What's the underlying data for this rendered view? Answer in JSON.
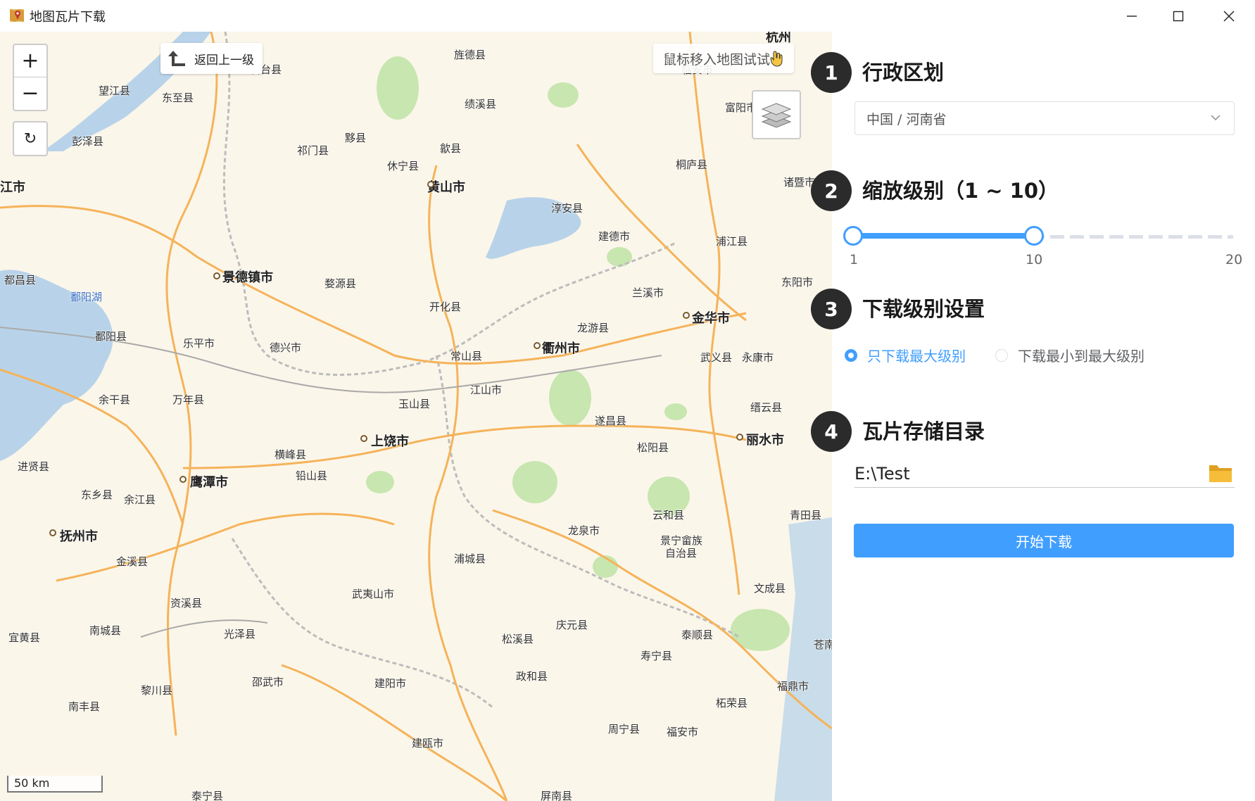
{
  "window": {
    "title": "地图瓦片下载"
  },
  "map": {
    "back_label": "返回上一级",
    "hint_text": "鼠标移入地图试试",
    "zoom_in": "+",
    "zoom_out": "−",
    "reset": "↻",
    "scale_label": "50 km",
    "cities": [
      {
        "name": "杭州",
        "major": true
      },
      {
        "name": "旌德县"
      },
      {
        "name": "望江县"
      },
      {
        "name": "东至县"
      },
      {
        "name": "石台县"
      },
      {
        "name": "临安市"
      },
      {
        "name": "绩溪县"
      },
      {
        "name": "富阳市"
      },
      {
        "name": "彭泽县"
      },
      {
        "name": "黟县"
      },
      {
        "name": "祁门县"
      },
      {
        "name": "歙县"
      },
      {
        "name": "休宁县"
      },
      {
        "name": "桐庐县"
      },
      {
        "name": "黄山市",
        "major": true
      },
      {
        "name": "江市"
      },
      {
        "name": "诸暨市"
      },
      {
        "name": "淳安县"
      },
      {
        "name": "建德市"
      },
      {
        "name": "浦江县"
      },
      {
        "name": "都昌县"
      },
      {
        "name": "景德镇市",
        "major": true
      },
      {
        "name": "婺源县"
      },
      {
        "name": "东阳市"
      },
      {
        "name": "鄱阳湖",
        "water": true
      },
      {
        "name": "兰溪市"
      },
      {
        "name": "开化县"
      },
      {
        "name": "金华市",
        "major": true
      },
      {
        "name": "龙游县"
      },
      {
        "name": "鄱阳县"
      },
      {
        "name": "乐平市"
      },
      {
        "name": "德兴市"
      },
      {
        "name": "常山县"
      },
      {
        "name": "衢州市",
        "major": true
      },
      {
        "name": "武义县"
      },
      {
        "name": "永康市"
      },
      {
        "name": "江山市"
      },
      {
        "name": "余干县"
      },
      {
        "name": "万年县"
      },
      {
        "name": "玉山县"
      },
      {
        "name": "缙云县"
      },
      {
        "name": "遂昌县"
      },
      {
        "name": "松阳县"
      },
      {
        "name": "丽水市",
        "major": true
      },
      {
        "name": "横峰县"
      },
      {
        "name": "上饶市",
        "major": true
      },
      {
        "name": "进贤县"
      },
      {
        "name": "铅山县"
      },
      {
        "name": "东乡县"
      },
      {
        "name": "余江县"
      },
      {
        "name": "鹰潭市",
        "major": true
      },
      {
        "name": "青田县"
      },
      {
        "name": "云和县"
      },
      {
        "name": "龙泉市"
      },
      {
        "name": "景宁畲族"
      },
      {
        "name": "自治县"
      },
      {
        "name": "抚州市",
        "major": true
      },
      {
        "name": "金溪县"
      },
      {
        "name": "浦城县"
      },
      {
        "name": "资溪县"
      },
      {
        "name": "武夷山市"
      },
      {
        "name": "文成县"
      },
      {
        "name": "庆元县"
      },
      {
        "name": "宜黄县"
      },
      {
        "name": "南城县"
      },
      {
        "name": "光泽县"
      },
      {
        "name": "松溪县"
      },
      {
        "name": "泰顺县"
      },
      {
        "name": "苍南"
      },
      {
        "name": "寿宁县"
      },
      {
        "name": "邵武市"
      },
      {
        "name": "政和县"
      },
      {
        "name": "建阳市"
      },
      {
        "name": "福鼎市"
      },
      {
        "name": "黎川县"
      },
      {
        "name": "柘荣县"
      },
      {
        "name": "南丰县"
      },
      {
        "name": "周宁县"
      },
      {
        "name": "福安市"
      },
      {
        "name": "建瓯市"
      },
      {
        "name": "泰宁县"
      },
      {
        "name": "屏南县"
      }
    ]
  },
  "panel": {
    "steps": [
      {
        "num": "1",
        "title": "行政区划"
      },
      {
        "num": "2",
        "title": "缩放级别（1 ~ 10）"
      },
      {
        "num": "3",
        "title": "下载级别设置"
      },
      {
        "num": "4",
        "title": "瓦片存储目录"
      }
    ],
    "region_value": "中国 / 河南省",
    "slider": {
      "min": 1,
      "max": 20,
      "low": 1,
      "high": 10,
      "tick_min": "1",
      "tick_mid": "10",
      "tick_max": "20"
    },
    "radio_options": [
      {
        "label": "只下载最大级别",
        "checked": true
      },
      {
        "label": "下载最小到最大级别",
        "checked": false
      }
    ],
    "directory_value": "E:\\Test",
    "start_button": "开始下载"
  },
  "colors": {
    "accent": "#409eff",
    "step_badge": "#2b2b2b",
    "map_bg": "#fbf6ea",
    "road": "#f5b35a",
    "water": "#a8cbe8",
    "forest": "#c8e6b0"
  }
}
